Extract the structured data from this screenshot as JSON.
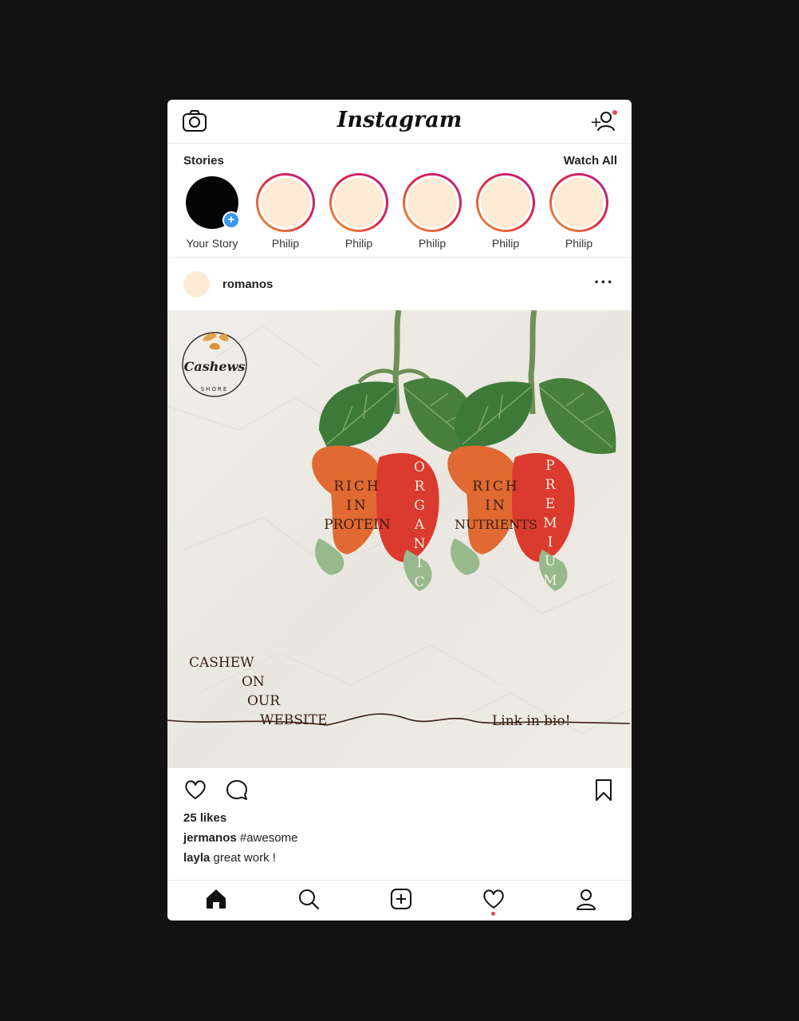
{
  "app": {
    "title": "Instagram"
  },
  "stories": {
    "heading": "Stories",
    "watch_all": "Watch All",
    "own_label": "Your Story",
    "items": [
      {
        "label": "Philip"
      },
      {
        "label": "Philip"
      },
      {
        "label": "Philip"
      },
      {
        "label": "Philip"
      },
      {
        "label": "Philip"
      }
    ]
  },
  "post": {
    "username": "romanos",
    "image": {
      "brand": "Cashews",
      "brand_sub": "SHORE",
      "cashew1_text": [
        "RICH",
        "IN",
        "PROTEIN"
      ],
      "cashew1_vertical": "ORGANIC",
      "cashew2_text": [
        "RICH",
        "IN",
        "NUTRIENTS"
      ],
      "cashew2_vertical": "PREMIUM",
      "cta_lines": [
        "CASHEW",
        "ON",
        "OUR",
        "WEBSITE"
      ],
      "link_text": "Link in bio!"
    },
    "likes": "25 likes",
    "comments": [
      {
        "user": "jermanos",
        "text": "#awesome"
      },
      {
        "user": "layla",
        "text": "great work !"
      }
    ]
  },
  "colors": {
    "accent_red": "#ed4956",
    "story_ring": "#c13584",
    "avatar_fill": "#fdebd6",
    "blue_badge": "#3897f0"
  },
  "icons": {
    "top_left": "camera-icon",
    "top_right": "add-user-icon",
    "actions": [
      "heart-icon",
      "comment-icon",
      "bookmark-icon"
    ],
    "nav": [
      "home-icon",
      "search-icon",
      "add-post-icon",
      "activity-heart-icon",
      "profile-icon"
    ]
  }
}
